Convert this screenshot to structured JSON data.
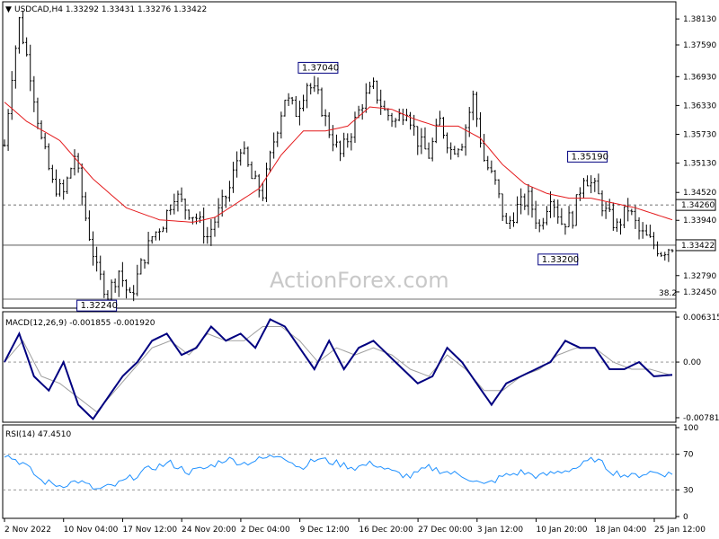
{
  "window": {
    "symbol_header": "USDCAD,H4  1.33292 1.33431 1.33276 1.33422",
    "watermark": "ActionForex.com"
  },
  "colors": {
    "candle": "#000000",
    "ma": "#e41a1c",
    "macd_line": "#000080",
    "signal_line": "#a0a0a0",
    "rsi": "#1e90ff",
    "level_line": "#404040"
  },
  "chart_data": [
    {
      "type": "candlestick",
      "title": "USDCAD,H4",
      "ohlc_header": {
        "open": 1.33292,
        "high": 1.33431,
        "low": 1.33276,
        "close": 1.33422
      },
      "price_ticks": [
        "1.38130",
        "1.37590",
        "1.36930",
        "1.36330",
        "1.35730",
        "1.35130",
        "1.34520",
        "1.33940",
        "1.33422",
        "1.32790",
        "1.32450"
      ],
      "ylim": [
        1.3215,
        1.3845
      ],
      "x_ticks": [
        "2 Nov 2022",
        "10 Nov 04:00",
        "17 Nov 12:00",
        "24 Nov 20:00",
        "2 Dec 04:00",
        "9 Dec 12:00",
        "16 Dec 20:00",
        "27 Dec 00:00",
        "3 Jan 12:00",
        "10 Jan 20:00",
        "18 Jan 04:00",
        "25 Jan 12:00"
      ],
      "path_anchors": [
        [
          0,
          1.355
        ],
        [
          2,
          1.37
        ],
        [
          4,
          1.381
        ],
        [
          7,
          1.37
        ],
        [
          10,
          1.356
        ],
        [
          13,
          1.347
        ],
        [
          16,
          1.345
        ],
        [
          19,
          1.353
        ],
        [
          22,
          1.34
        ],
        [
          25,
          1.329
        ],
        [
          28,
          1.324
        ],
        [
          31,
          1.329
        ],
        [
          34,
          1.323
        ],
        [
          37,
          1.33
        ],
        [
          40,
          1.336
        ],
        [
          43,
          1.339
        ],
        [
          46,
          1.345
        ],
        [
          49,
          1.342
        ],
        [
          52,
          1.34
        ],
        [
          55,
          1.336
        ],
        [
          58,
          1.341
        ],
        [
          61,
          1.346
        ],
        [
          64,
          1.355
        ],
        [
          67,
          1.348
        ],
        [
          70,
          1.345
        ],
        [
          73,
          1.356
        ],
        [
          76,
          1.365
        ],
        [
          79,
          1.362
        ],
        [
          82,
          1.368
        ],
        [
          85,
          1.365
        ],
        [
          88,
          1.358
        ],
        [
          91,
          1.353
        ],
        [
          94,
          1.358
        ],
        [
          97,
          1.364
        ],
        [
          100,
          1.367
        ],
        [
          103,
          1.362
        ],
        [
          106,
          1.36
        ],
        [
          109,
          1.363
        ],
        [
          112,
          1.356
        ],
        [
          115,
          1.353
        ],
        [
          118,
          1.36
        ],
        [
          121,
          1.354
        ],
        [
          124,
          1.356
        ],
        [
          127,
          1.365
        ],
        [
          130,
          1.352
        ],
        [
          133,
          1.347
        ],
        [
          136,
          1.338
        ],
        [
          139,
          1.342
        ],
        [
          142,
          1.344
        ],
        [
          145,
          1.338
        ],
        [
          148,
          1.345
        ],
        [
          151,
          1.339
        ],
        [
          154,
          1.34
        ],
        [
          157,
          1.349
        ],
        [
          160,
          1.346
        ],
        [
          163,
          1.341
        ],
        [
          166,
          1.338
        ],
        [
          169,
          1.342
        ],
        [
          172,
          1.337
        ],
        [
          175,
          1.335
        ],
        [
          178,
          1.333
        ],
        [
          181,
          1.3342
        ]
      ],
      "ma_anchors": [
        [
          0,
          1.364
        ],
        [
          6,
          1.36
        ],
        [
          15,
          1.356
        ],
        [
          24,
          1.348
        ],
        [
          33,
          1.342
        ],
        [
          42,
          1.3395
        ],
        [
          51,
          1.339
        ],
        [
          57,
          1.34
        ],
        [
          63,
          1.343
        ],
        [
          69,
          1.346
        ],
        [
          75,
          1.353
        ],
        [
          81,
          1.358
        ],
        [
          87,
          1.358
        ],
        [
          93,
          1.359
        ],
        [
          99,
          1.363
        ],
        [
          105,
          1.3625
        ],
        [
          111,
          1.3605
        ],
        [
          117,
          1.359
        ],
        [
          123,
          1.359
        ],
        [
          129,
          1.3565
        ],
        [
          135,
          1.351
        ],
        [
          141,
          1.347
        ],
        [
          147,
          1.345
        ],
        [
          153,
          1.344
        ],
        [
          159,
          1.344
        ],
        [
          165,
          1.343
        ],
        [
          171,
          1.342
        ],
        [
          177,
          1.3405
        ],
        [
          181,
          1.3395
        ]
      ],
      "annotations": [
        {
          "label": "1.37040",
          "bar": 85,
          "price": 1.3704
        },
        {
          "label": "1.35190",
          "bar": 158,
          "price": 1.3519
        },
        {
          "label": "1.33200",
          "bar": 150,
          "price": 1.332
        },
        {
          "label": "1.32240",
          "bar": 25,
          "price": 1.3224
        }
      ],
      "level_lines": [
        {
          "label": "1.34260",
          "price": 1.3426,
          "style": "dashed"
        },
        {
          "label": "1.33422",
          "price": 1.33422,
          "style": "solid"
        },
        {
          "label": "38.2",
          "price": 1.323,
          "style": "solid"
        }
      ],
      "ma_label": "",
      "current_price_label": "1.33422",
      "level_label_1": "1.34260",
      "fib_label": "38.2"
    },
    {
      "type": "line",
      "title": "MACD(12,26,9) -0.001855 -0.001920",
      "ticks": [
        "0.006315",
        "0.00",
        "-0.007818"
      ],
      "ylim": [
        -0.0082,
        0.0067
      ],
      "series": [
        {
          "name": "MACD",
          "anchors": [
            [
              0,
              0.0
            ],
            [
              4,
              0.004
            ],
            [
              8,
              -0.002
            ],
            [
              12,
              -0.004
            ],
            [
              16,
              0.0
            ],
            [
              20,
              -0.006
            ],
            [
              24,
              -0.008
            ],
            [
              28,
              -0.005
            ],
            [
              32,
              -0.002
            ],
            [
              36,
              0.0
            ],
            [
              40,
              0.003
            ],
            [
              44,
              0.004
            ],
            [
              48,
              0.001
            ],
            [
              52,
              0.002
            ],
            [
              56,
              0.005
            ],
            [
              60,
              0.003
            ],
            [
              64,
              0.004
            ],
            [
              68,
              0.002
            ],
            [
              72,
              0.006
            ],
            [
              76,
              0.005
            ],
            [
              80,
              0.002
            ],
            [
              84,
              -0.001
            ],
            [
              88,
              0.003
            ],
            [
              92,
              -0.001
            ],
            [
              96,
              0.002
            ],
            [
              100,
              0.003
            ],
            [
              104,
              0.001
            ],
            [
              108,
              -0.001
            ],
            [
              112,
              -0.003
            ],
            [
              116,
              -0.002
            ],
            [
              120,
              0.002
            ],
            [
              124,
              0.0
            ],
            [
              128,
              -0.003
            ],
            [
              132,
              -0.006
            ],
            [
              136,
              -0.003
            ],
            [
              140,
              -0.002
            ],
            [
              144,
              -0.001
            ],
            [
              148,
              0.0
            ],
            [
              152,
              0.003
            ],
            [
              156,
              0.002
            ],
            [
              160,
              0.002
            ],
            [
              164,
              -0.001
            ],
            [
              168,
              -0.001
            ],
            [
              172,
              0.0
            ],
            [
              176,
              -0.002
            ],
            [
              181,
              -0.0018
            ]
          ]
        },
        {
          "name": "Signal",
          "anchors": [
            [
              0,
              0.0
            ],
            [
              5,
              0.003
            ],
            [
              10,
              -0.002
            ],
            [
              15,
              -0.003
            ],
            [
              20,
              -0.005
            ],
            [
              25,
              -0.007
            ],
            [
              30,
              -0.004
            ],
            [
              35,
              -0.001
            ],
            [
              40,
              0.002
            ],
            [
              45,
              0.003
            ],
            [
              50,
              0.001
            ],
            [
              55,
              0.004
            ],
            [
              60,
              0.003
            ],
            [
              65,
              0.003
            ],
            [
              70,
              0.005
            ],
            [
              75,
              0.005
            ],
            [
              80,
              0.003
            ],
            [
              85,
              0.0
            ],
            [
              90,
              0.002
            ],
            [
              95,
              0.001
            ],
            [
              100,
              0.002
            ],
            [
              105,
              0.001
            ],
            [
              110,
              -0.001
            ],
            [
              115,
              -0.002
            ],
            [
              120,
              0.001
            ],
            [
              125,
              -0.001
            ],
            [
              130,
              -0.004
            ],
            [
              135,
              -0.004
            ],
            [
              140,
              -0.002
            ],
            [
              145,
              -0.001
            ],
            [
              150,
              0.001
            ],
            [
              155,
              0.002
            ],
            [
              160,
              0.002
            ],
            [
              165,
              0.0
            ],
            [
              170,
              -0.001
            ],
            [
              175,
              -0.001
            ],
            [
              181,
              -0.0019
            ]
          ]
        }
      ]
    },
    {
      "type": "line",
      "title": "RSI(14) 47.4510",
      "ticks": [
        "100",
        "70",
        "30",
        "0"
      ],
      "ylim": [
        0,
        100
      ],
      "series": [
        {
          "name": "RSI",
          "anchors": [
            [
              0,
              70
            ],
            [
              5,
              60
            ],
            [
              10,
              40
            ],
            [
              15,
              35
            ],
            [
              20,
              40
            ],
            [
              25,
              30
            ],
            [
              30,
              35
            ],
            [
              35,
              45
            ],
            [
              40,
              55
            ],
            [
              45,
              60
            ],
            [
              50,
              50
            ],
            [
              55,
              55
            ],
            [
              60,
              65
            ],
            [
              65,
              60
            ],
            [
              70,
              65
            ],
            [
              75,
              70
            ],
            [
              80,
              55
            ],
            [
              85,
              65
            ],
            [
              90,
              60
            ],
            [
              95,
              55
            ],
            [
              100,
              60
            ],
            [
              105,
              50
            ],
            [
              110,
              45
            ],
            [
              115,
              55
            ],
            [
              120,
              50
            ],
            [
              125,
              45
            ],
            [
              130,
              35
            ],
            [
              135,
              45
            ],
            [
              140,
              50
            ],
            [
              145,
              45
            ],
            [
              150,
              50
            ],
            [
              155,
              55
            ],
            [
              160,
              65
            ],
            [
              165,
              50
            ],
            [
              170,
              45
            ],
            [
              175,
              50
            ],
            [
              181,
              47.45
            ]
          ]
        }
      ]
    }
  ]
}
